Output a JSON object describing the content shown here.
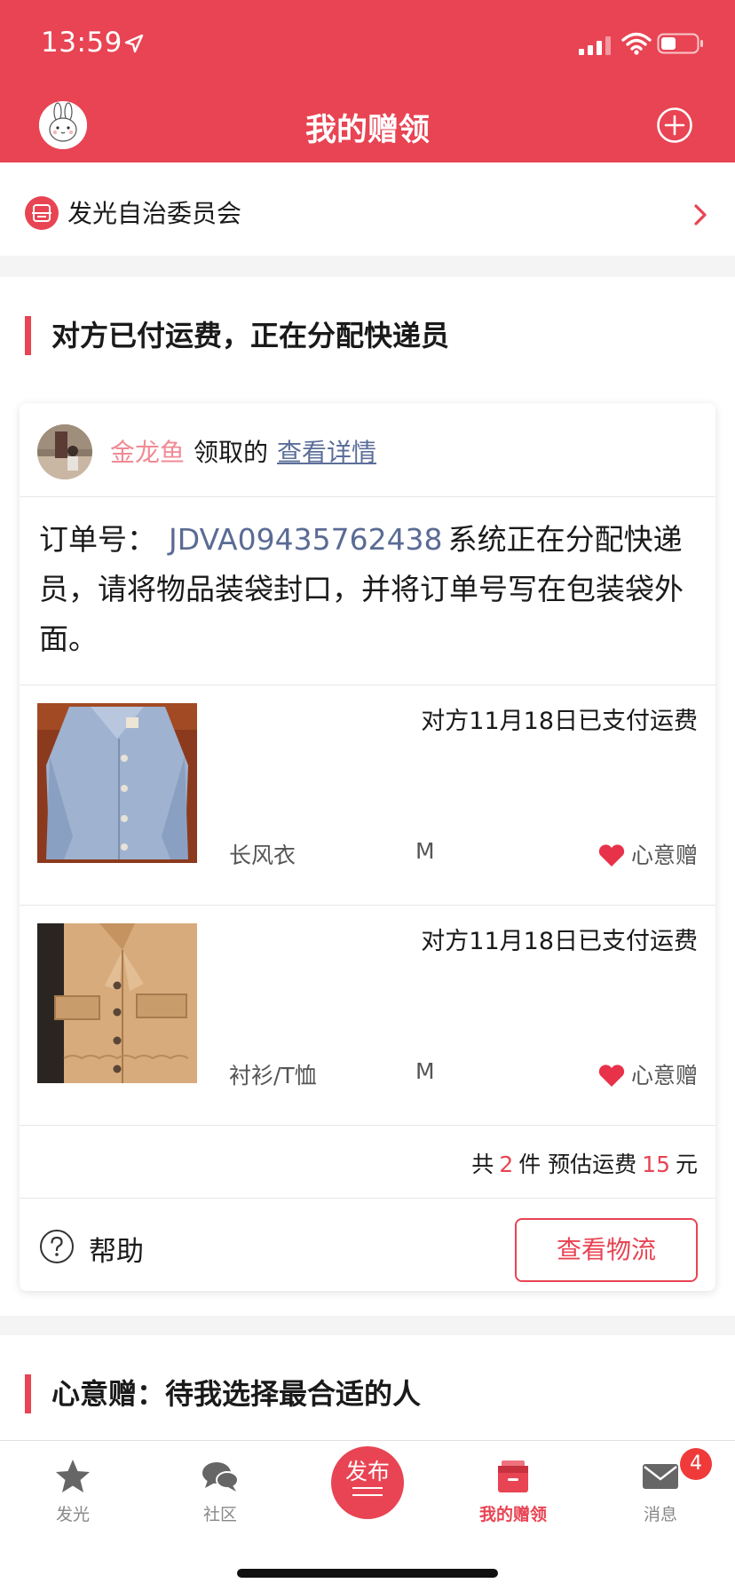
{
  "status_bar": {
    "time": "13:59"
  },
  "header": {
    "title": "我的赠领"
  },
  "org": {
    "name": "发光自治委员会"
  },
  "section1": {
    "title": "对方已付运费，正在分配快递员",
    "card": {
      "taker": {
        "name": "金龙鱼",
        "verb": "领取的",
        "link": "查看详情"
      },
      "order": {
        "label": "订单号：",
        "number": "JDVA09435762438",
        "message": "系统正在分配快递员，请将物品装袋封口，并将订单号写在包装袋外面。"
      },
      "items": [
        {
          "status": "对方11月18日已支付运费",
          "name": "长风衣",
          "size": "M",
          "tag": "心意赠",
          "photo_color": "#9fb2cf"
        },
        {
          "status": "对方11月18日已支付运费",
          "name": "衬衫/T恤",
          "size": "M",
          "tag": "心意赠",
          "photo_color": "#d8ab7c"
        }
      ],
      "summary": {
        "prefix": "共",
        "count": "2",
        "count_unit": "件 预估运费",
        "fee": "15",
        "fee_unit": "元"
      },
      "help_label": "帮助",
      "logistics_button": "查看物流"
    }
  },
  "section2": {
    "title": "心意赠：待我选择最合适的人"
  },
  "tabbar": {
    "tabs": [
      {
        "label": "发光",
        "icon": "star-icon"
      },
      {
        "label": "社区",
        "icon": "chat-bubble-icon"
      },
      {
        "label": "发布",
        "icon": "publish-icon"
      },
      {
        "label": "我的赠领",
        "icon": "gift-box-icon",
        "active": true
      },
      {
        "label": "消息",
        "icon": "mail-icon",
        "badge": "4"
      }
    ]
  },
  "colors": {
    "brand": "#e84453",
    "link": "#5c6e99",
    "taker_name": "#f08a95"
  }
}
